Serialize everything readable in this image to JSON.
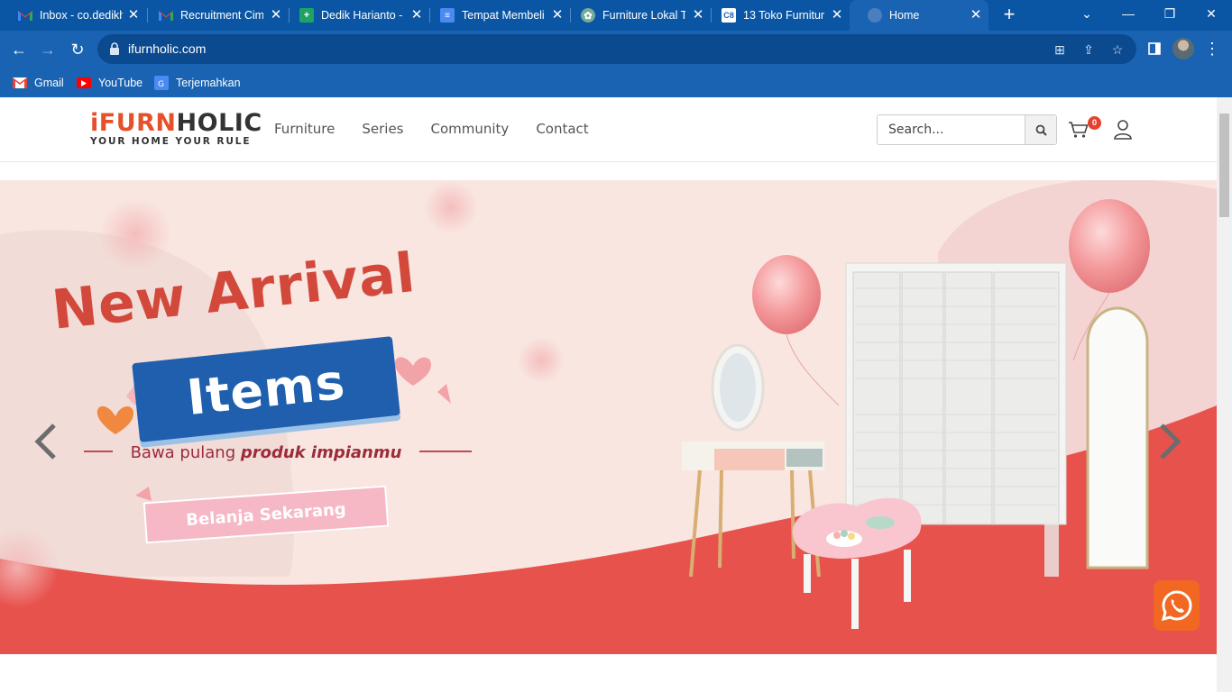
{
  "browser": {
    "tabs": [
      {
        "title": "Inbox - co.dedikh",
        "favicon": "gmail-icon"
      },
      {
        "title": "Recruitment Cimb",
        "favicon": "gmail-icon"
      },
      {
        "title": "Dedik Harianto - ",
        "favicon": "sheets-icon"
      },
      {
        "title": "Tempat Membeli ",
        "favicon": "docs-icon"
      },
      {
        "title": "Furniture Lokal T",
        "favicon": "chatgpt-icon"
      },
      {
        "title": "13 Toko Furnitur",
        "favicon": "c-icon"
      },
      {
        "title": "Home",
        "favicon": "globe-icon"
      }
    ],
    "url": "ifurnholic.com",
    "bookmarks": [
      {
        "label": "Gmail",
        "icon": "gmail-icon"
      },
      {
        "label": "YouTube",
        "icon": "youtube-icon"
      },
      {
        "label": "Terjemahkan",
        "icon": "translate-icon"
      }
    ]
  },
  "site": {
    "logo": {
      "part1": "iFURN",
      "part2": "HOLIC",
      "tagline": "YOUR HOME YOUR RULE"
    },
    "menu": [
      "Furniture",
      "Series",
      "Community",
      "Contact"
    ],
    "search_placeholder": "Search...",
    "cart_count": "0"
  },
  "banner": {
    "headline": "New Arrival",
    "ribbon": "Items",
    "tagline_prefix": "Bawa pulang ",
    "tagline_bold": "produk impianmu",
    "cta": "Belanja Sekarang"
  },
  "colors": {
    "brand_orange": "#e4512a",
    "chrome_blue": "#1a63b3",
    "banner_red": "#e8524d",
    "whatsapp_orange": "#f26722"
  }
}
